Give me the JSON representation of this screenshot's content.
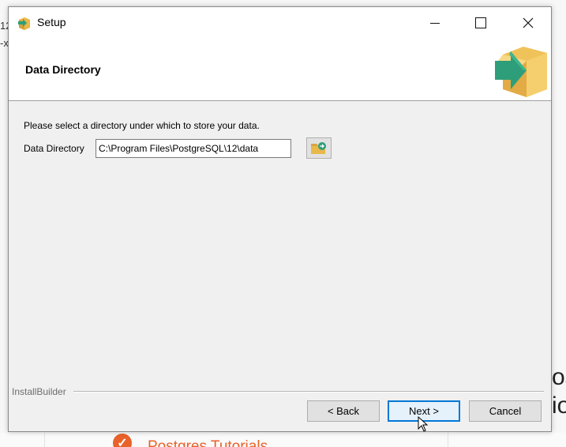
{
  "background": {
    "left_fragment": [
      "12",
      "-x"
    ],
    "right_fragment": [
      "os",
      "io"
    ],
    "link_text": "Postgres Tutorials",
    "check_icon": "check-circle-icon"
  },
  "window": {
    "title": "Setup",
    "controls": [
      "minimize",
      "maximize",
      "close"
    ]
  },
  "header": {
    "title": "Data Directory",
    "icon": "installer-box-arrow-icon"
  },
  "content": {
    "prompt": "Please select a directory under which to store your data.",
    "field_label": "Data Directory",
    "field_value": "C:\\Program Files\\PostgreSQL\\12\\data",
    "browse_icon": "folder-browse-icon"
  },
  "footer": {
    "brand": "InstallBuilder",
    "back_label": "< Back",
    "next_label": "Next >",
    "cancel_label": "Cancel"
  },
  "colors": {
    "accent": "#0078d7",
    "link": "#e8622a",
    "icon_green": "#2e9e7a",
    "icon_box": "#e8b84a"
  }
}
